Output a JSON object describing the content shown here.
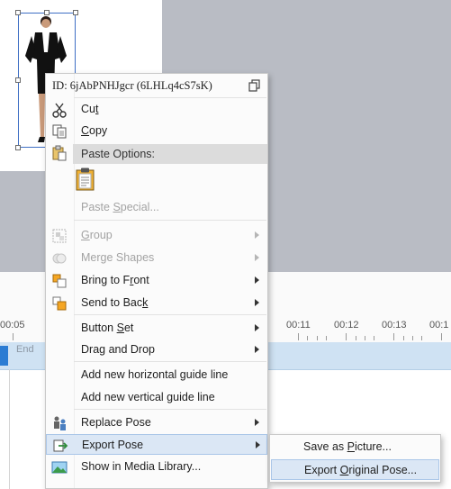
{
  "canvas": {
    "selected_character": "business woman pose"
  },
  "timeline": {
    "ticks": [
      "00:05",
      "00:11",
      "00:12",
      "00:13",
      "00:1"
    ],
    "track_end_label": "End"
  },
  "context_menu": {
    "id_text": "ID: 6jAbPNHJgcr  (6LHLq4cS7sK)",
    "copy_id_icon": "copy-icon",
    "items": {
      "cut": {
        "pre": "Cu",
        "key": "t",
        "post": ""
      },
      "copy": {
        "pre": "",
        "key": "C",
        "post": "opy"
      },
      "paste_options_header": "Paste Options:",
      "paste_special": {
        "pre": "Paste ",
        "key": "S",
        "post": "pecial..."
      },
      "group": {
        "pre": "",
        "key": "G",
        "post": "roup"
      },
      "merge_shapes": "Merge Shapes",
      "bring_to_front": {
        "pre": "Bring to F",
        "key": "r",
        "post": "ont"
      },
      "send_to_back": {
        "pre": "Send to Bac",
        "key": "k",
        "post": ""
      },
      "button_set": {
        "pre": "Button ",
        "key": "S",
        "post": "et"
      },
      "drag_and_drop": "Drag and Drop",
      "add_h_guide": "Add new horizontal guide line",
      "add_v_guide": "Add new vertical guide line",
      "replace_pose": "Replace Pose",
      "export_pose": "Export Pose",
      "show_in_media_library": "Show in Media Library..."
    }
  },
  "submenu": {
    "save_as_picture": {
      "pre": "Save as ",
      "key": "P",
      "post": "icture..."
    },
    "export_original_pose": {
      "pre": "Export ",
      "key": "O",
      "post": "riginal Pose..."
    }
  },
  "colors": {
    "menu_highlight": "#dbe7f5",
    "track": "#cfe2f3",
    "selection": "#3f6fc4",
    "canvas_bg": "#b9bcc4"
  }
}
